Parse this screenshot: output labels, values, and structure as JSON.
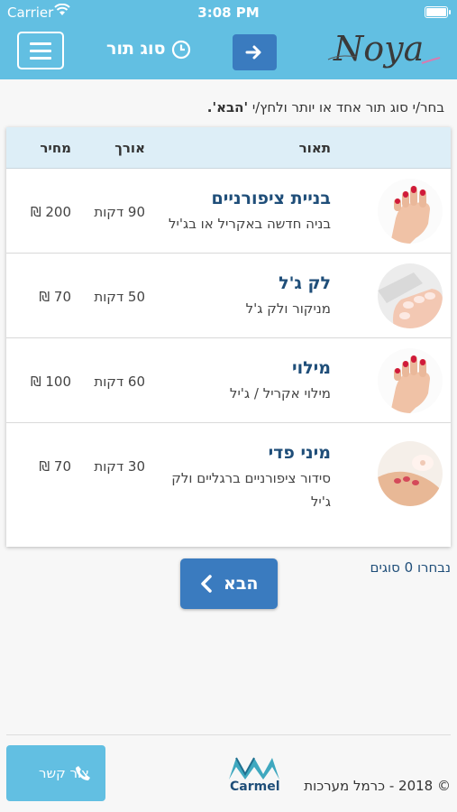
{
  "status": {
    "carrier": "Carrier",
    "time": "3:08 PM"
  },
  "header": {
    "title": "סוג תור",
    "logo_text": "Noya"
  },
  "instruction": {
    "text": "בחר/י סוג תור אחד או יותר ולחץ/י ",
    "emphasis": "'הבא'."
  },
  "table": {
    "headers": {
      "description": "תאור",
      "length": "אורך",
      "price": "מחיר"
    },
    "rows": [
      {
        "name": "בניית ציפורניים",
        "desc": "בניה חדשה באקריל או בג'יל",
        "length": "90 דקות",
        "price": "200 ₪",
        "image": "red-nails-image"
      },
      {
        "name": "לק ג'ל",
        "desc": "מניקור ולק ג'ל",
        "length": "50 דקות",
        "price": "70 ₪",
        "image": "french-nails-image"
      },
      {
        "name": "מילוי",
        "desc": "מילוי אקריל / ג'יל",
        "length": "60 דקות",
        "price": "100 ₪",
        "image": "red-nails-image"
      },
      {
        "name": "מיני פדי",
        "desc": "סידור ציפורניים ברגליים ולק ג'יל",
        "length": "30 דקות",
        "price": "70 ₪",
        "image": "pedicure-image"
      }
    ]
  },
  "selection": {
    "count_text": "נבחרו 0 סוגים"
  },
  "next_button": {
    "label": "הבא"
  },
  "footer": {
    "contact_label": "צור קשר",
    "company_logo": "Carmel",
    "copyright": "© 2018 - כרמל מערכות"
  },
  "colors": {
    "header": "#62bfe2",
    "button": "#3a7bbf",
    "title_text": "#1f4e79",
    "table_header": "#ddeef7"
  }
}
